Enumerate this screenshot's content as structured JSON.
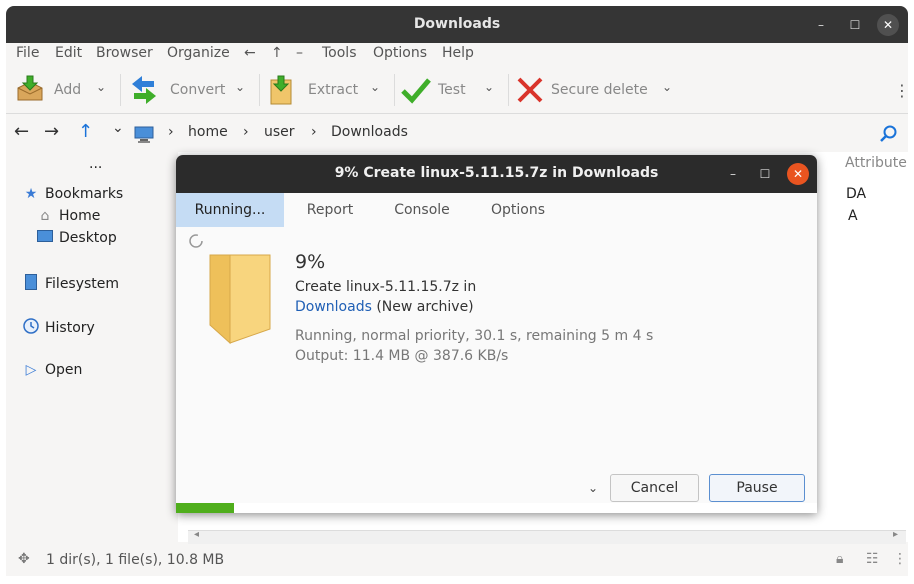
{
  "main": {
    "title": "Downloads",
    "controls": {
      "minimize": "–",
      "maximize": "☐",
      "close": "✕"
    },
    "menu": [
      "File",
      "Edit",
      "Browser",
      "Organize",
      "←",
      "↑",
      "–",
      "Tools",
      "Options",
      "Help"
    ],
    "toolbar": {
      "add": "Add",
      "convert": "Convert",
      "extract": "Extract",
      "test": "Test",
      "secure_delete": "Secure delete",
      "dropdown": "⌄",
      "more": "⋮"
    },
    "nav": {
      "back": "←",
      "forward": "→",
      "up": "↑",
      "dropdown": "⌄",
      "separator": "›",
      "crumbs": [
        "home",
        "user",
        "Downloads"
      ]
    },
    "sidebar": {
      "more": "...",
      "bookmarks": "Bookmarks",
      "home": "Home",
      "desktop": "Desktop",
      "filesystem": "Filesystem",
      "history": "History",
      "open": "Open"
    },
    "filelist": {
      "column_header": "Attribute",
      "values": [
        "DA",
        "A"
      ]
    },
    "status": {
      "text": "1 dir(s), 1 file(s), 10.8 MB"
    }
  },
  "dialog": {
    "title": "9% Create linux-5.11.15.7z in Downloads",
    "tabs": [
      "Running...",
      "Report",
      "Console",
      "Options"
    ],
    "percent": "9%",
    "line1": "Create linux-5.11.15.7z in",
    "link": "Downloads",
    "line2_suffix": "(New archive)",
    "status": "Running, normal priority, 30.1 s, remaining 5 m 4 s",
    "output": "Output: 11.4 MB @ 387.6 KB/s",
    "dropdown": "⌄",
    "cancel": "Cancel",
    "pause": "Pause",
    "progress": 0.09,
    "controls": {
      "minimize": "–",
      "maximize": "☐",
      "close": "✕"
    }
  }
}
